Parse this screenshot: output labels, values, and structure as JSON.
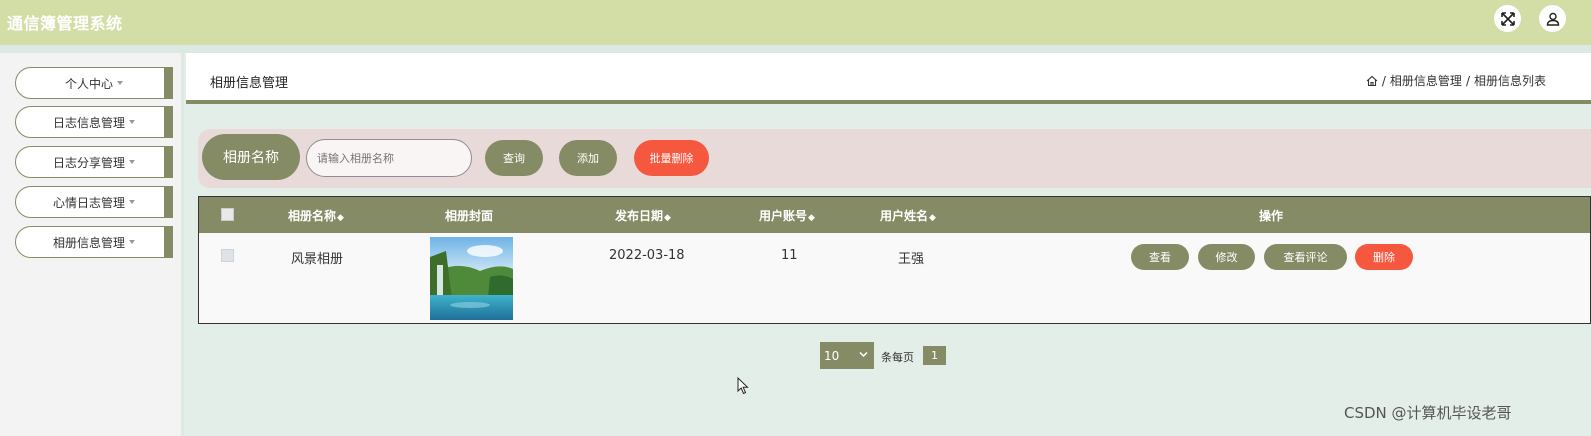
{
  "app": {
    "title": "通信簿管理系统"
  },
  "topbar": {
    "fullscreen_icon": "expand-arrows-icon",
    "user_icon": "user-icon"
  },
  "sidebar": {
    "items": [
      {
        "label": "个人中心"
      },
      {
        "label": "日志信息管理"
      },
      {
        "label": "日志分享管理"
      },
      {
        "label": "心情日志管理"
      },
      {
        "label": "相册信息管理"
      }
    ]
  },
  "header": {
    "title": "相册信息管理",
    "breadcrumb": [
      "相册信息管理",
      "相册信息列表"
    ],
    "breadcrumb_sep": "/"
  },
  "search": {
    "label": "相册名称",
    "placeholder": "请输入相册名称",
    "query_label": "查询",
    "add_label": "添加",
    "batch_delete_label": "批量删除"
  },
  "table": {
    "columns": [
      "相册名称",
      "相册封面",
      "发布日期",
      "用户账号",
      "用户姓名",
      "操作"
    ],
    "rows": [
      {
        "name": "风景相册",
        "cover": "landscape-waterfall-image",
        "date": "2022-03-18",
        "account": "11",
        "username": "王强",
        "actions": [
          "查看",
          "修改",
          "查看评论",
          "删除"
        ]
      }
    ]
  },
  "pagination": {
    "page_size": "10",
    "per_page_label": "条每页",
    "current_page": "1"
  },
  "watermark": "CSDN @计算机毕设老哥",
  "colors": {
    "olive": "#858c65",
    "topbar": "#d3dea7",
    "danger": "#f5573f",
    "search_bg": "#e8dad8"
  }
}
